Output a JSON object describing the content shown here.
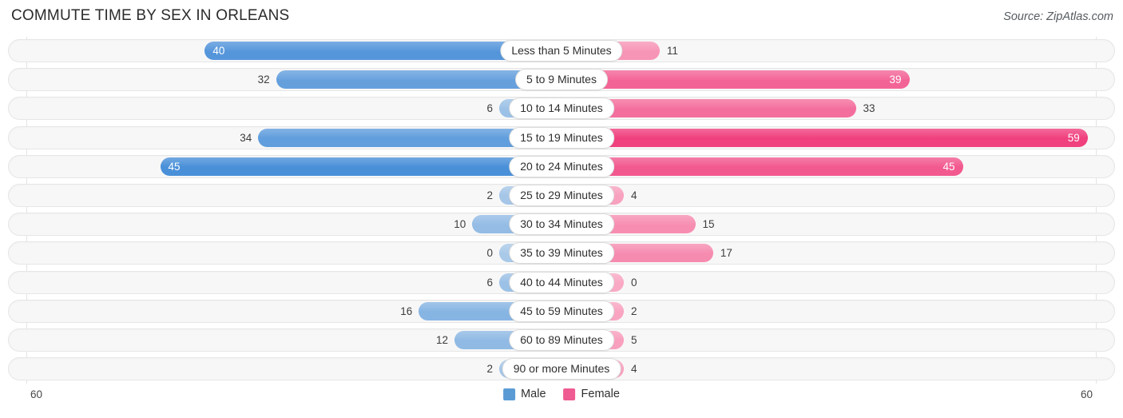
{
  "header": {
    "title": "COMMUTE TIME BY SEX IN ORLEANS",
    "source": "Source: ZipAtlas.com"
  },
  "axis": {
    "left_max_label": "60",
    "right_max_label": "60"
  },
  "legend": {
    "items": [
      {
        "label": "Male",
        "color": "#5b9bd5"
      },
      {
        "label": "Female",
        "color": "#ef5c92"
      }
    ]
  },
  "chart_data": {
    "type": "bar",
    "title": "COMMUTE TIME BY SEX IN ORLEANS",
    "subtitle": "Source: ZipAtlas.com",
    "orientation": "horizontal-diverging",
    "xlabel": "",
    "ylabel": "",
    "xlim": [
      60,
      60
    ],
    "grid": true,
    "legend_position": "bottom-center",
    "categories": [
      "Less than 5 Minutes",
      "5 to 9 Minutes",
      "10 to 14 Minutes",
      "15 to 19 Minutes",
      "20 to 24 Minutes",
      "25 to 29 Minutes",
      "30 to 34 Minutes",
      "35 to 39 Minutes",
      "40 to 44 Minutes",
      "45 to 59 Minutes",
      "60 to 89 Minutes",
      "90 or more Minutes"
    ],
    "series": [
      {
        "name": "Male",
        "color": "#5b9bd5",
        "side": "left",
        "values": [
          40,
          32,
          6,
          34,
          45,
          2,
          10,
          0,
          6,
          16,
          12,
          2
        ]
      },
      {
        "name": "Female",
        "color": "#ef5c92",
        "side": "right",
        "values": [
          11,
          39,
          33,
          59,
          45,
          4,
          15,
          17,
          0,
          2,
          5,
          4
        ]
      }
    ],
    "rows": [
      {
        "label": "Less than 5 Minutes",
        "male": 40,
        "female": 11
      },
      {
        "label": "5 to 9 Minutes",
        "male": 32,
        "female": 39
      },
      {
        "label": "10 to 14 Minutes",
        "male": 6,
        "female": 33
      },
      {
        "label": "15 to 19 Minutes",
        "male": 34,
        "female": 59
      },
      {
        "label": "20 to 24 Minutes",
        "male": 45,
        "female": 45
      },
      {
        "label": "25 to 29 Minutes",
        "male": 2,
        "female": 4
      },
      {
        "label": "30 to 34 Minutes",
        "male": 10,
        "female": 15
      },
      {
        "label": "35 to 39 Minutes",
        "male": 0,
        "female": 17
      },
      {
        "label": "40 to 44 Minutes",
        "male": 6,
        "female": 0
      },
      {
        "label": "45 to 59 Minutes",
        "male": 16,
        "female": 2
      },
      {
        "label": "60 to 89 Minutes",
        "male": 12,
        "female": 5
      },
      {
        "label": "90 or more Minutes",
        "male": 2,
        "female": 4
      }
    ]
  }
}
